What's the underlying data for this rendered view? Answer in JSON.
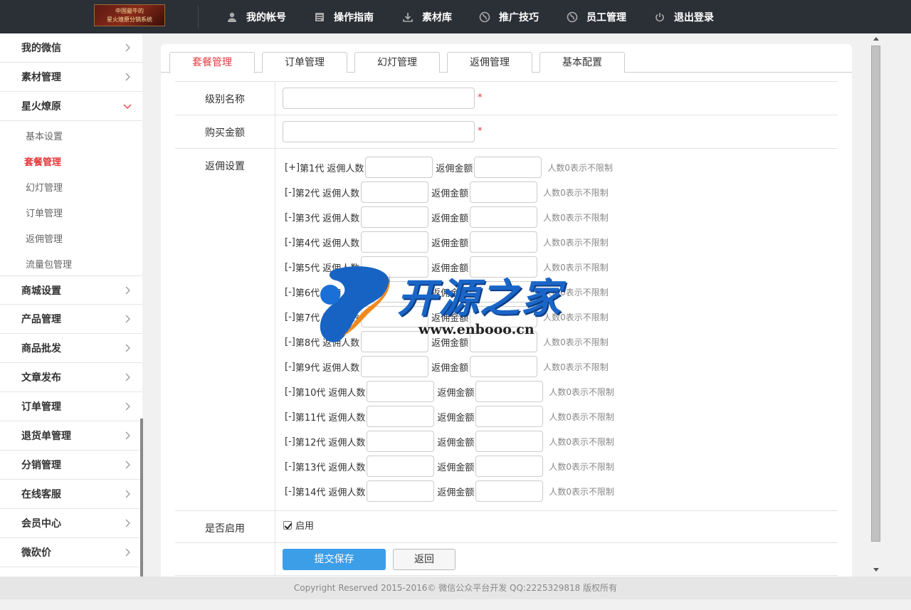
{
  "header": {
    "logo_line1": "中国最牛的",
    "logo_line2": "星火燎原分销系统",
    "nav": [
      {
        "label": "我的帐号",
        "icon": "user-icon"
      },
      {
        "label": "操作指南",
        "icon": "document-icon"
      },
      {
        "label": "素材库",
        "icon": "download-icon"
      },
      {
        "label": "推广技巧",
        "icon": "globe-icon"
      },
      {
        "label": "员工管理",
        "icon": "globe-icon"
      },
      {
        "label": "退出登录",
        "icon": "power-icon"
      }
    ]
  },
  "sidebar": {
    "items": [
      {
        "label": "我的微信"
      },
      {
        "label": "素材管理"
      },
      {
        "label": "星火燎原",
        "expanded": true
      }
    ],
    "subitems": [
      {
        "label": "基本设置"
      },
      {
        "label": "套餐管理",
        "active": true
      },
      {
        "label": "幻灯管理"
      },
      {
        "label": "订单管理"
      },
      {
        "label": "返佣管理"
      },
      {
        "label": "流量包管理"
      }
    ],
    "items_after": [
      {
        "label": "商城设置"
      },
      {
        "label": "产品管理"
      },
      {
        "label": "商品批发"
      },
      {
        "label": "文章发布"
      },
      {
        "label": "订单管理"
      },
      {
        "label": "退货单管理"
      },
      {
        "label": "分销管理"
      },
      {
        "label": "在线客服"
      },
      {
        "label": "会员中心"
      },
      {
        "label": "微砍价"
      }
    ]
  },
  "tabs": [
    {
      "label": "套餐管理",
      "active": true
    },
    {
      "label": "订单管理"
    },
    {
      "label": "幻灯管理"
    },
    {
      "label": "返佣管理"
    },
    {
      "label": "基本配置"
    }
  ],
  "form": {
    "level_name_label": "级别名称",
    "level_name_value": "",
    "amount_label": "购买金额",
    "amount_value": "",
    "required_mark": "*",
    "commission_label": "返佣设置",
    "count_label": "返佣人数",
    "money_label": "返佣金额",
    "hint": "人数0表示不限制",
    "generations": [
      {
        "prefix": "[+]",
        "gen": "第1代"
      },
      {
        "prefix": "[-]",
        "gen": "第2代"
      },
      {
        "prefix": "[-]",
        "gen": "第3代"
      },
      {
        "prefix": "[-]",
        "gen": "第4代"
      },
      {
        "prefix": "[-]",
        "gen": "第5代"
      },
      {
        "prefix": "[-]",
        "gen": "第6代"
      },
      {
        "prefix": "[-]",
        "gen": "第7代"
      },
      {
        "prefix": "[-]",
        "gen": "第8代"
      },
      {
        "prefix": "[-]",
        "gen": "第9代"
      },
      {
        "prefix": "[-]",
        "gen": "第10代"
      },
      {
        "prefix": "[-]",
        "gen": "第11代"
      },
      {
        "prefix": "[-]",
        "gen": "第12代"
      },
      {
        "prefix": "[-]",
        "gen": "第13代"
      },
      {
        "prefix": "[-]",
        "gen": "第14代"
      }
    ],
    "enable_label": "是否启用",
    "enable_checkbox_label": "启用",
    "enable_checked": true,
    "submit_label": "提交保存",
    "back_label": "返回"
  },
  "watermark": {
    "title": "开源之家",
    "url": "www.enbooo.cn"
  },
  "footer": {
    "text": "Copyright Reserved 2015-2016© 微信公众平台开发 QQ:2225329818 版权所有"
  },
  "colors": {
    "topbar_bg": "#2b2f36",
    "accent_red": "#e4393c",
    "primary_blue": "#3d9ee8"
  }
}
